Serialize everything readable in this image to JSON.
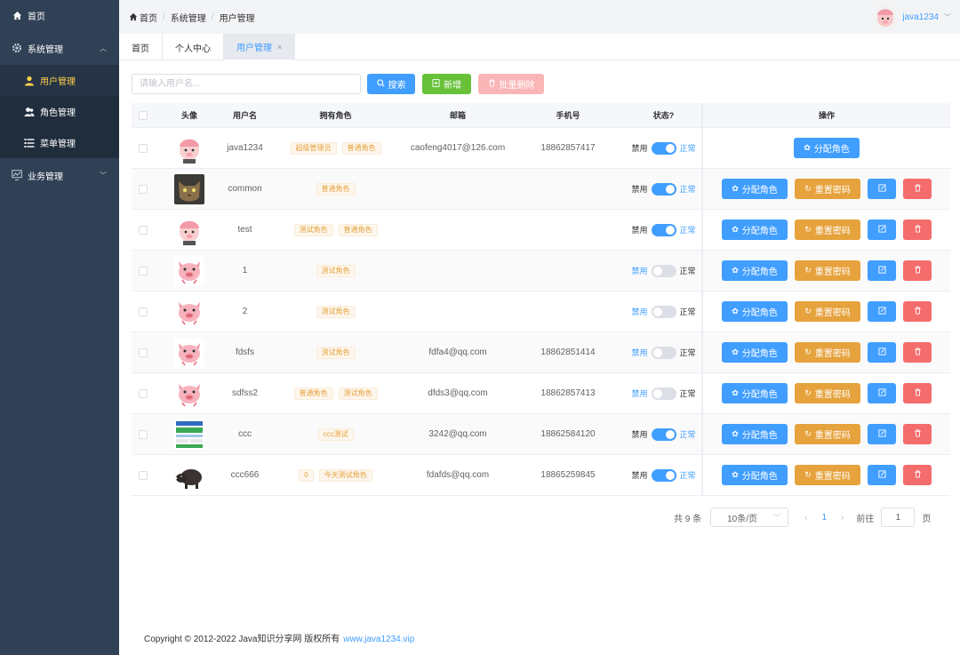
{
  "sidebar": {
    "home": "首页",
    "system": "系统管理",
    "items": [
      "用户管理",
      "角色管理",
      "菜单管理"
    ],
    "business": "业务管理"
  },
  "header": {
    "crumbs": [
      "首页",
      "系统管理",
      "用户管理"
    ],
    "username": "java1234"
  },
  "tabs": [
    "首页",
    "个人中心",
    "用户管理"
  ],
  "toolbar": {
    "placeholder": "请输入用户名...",
    "search": "搜索",
    "add": "新增",
    "batch_delete": "批量删除"
  },
  "table": {
    "headers": [
      "头像",
      "用户名",
      "拥有角色",
      "邮箱",
      "手机号",
      "状态?",
      "操作"
    ],
    "status_off": "禁用",
    "status_on": "正常",
    "assign": "分配角色",
    "reset": "重置密码",
    "rows": [
      {
        "username": "java1234",
        "roles": [
          "超级管理员",
          "普通角色"
        ],
        "email": "caofeng4017@126.com",
        "phone": "18862857417",
        "enabled": true,
        "avatar": "pig-face",
        "admin": true
      },
      {
        "username": "common",
        "roles": [
          "普通角色"
        ],
        "email": "",
        "phone": "",
        "enabled": true,
        "avatar": "cat-photo",
        "admin": false
      },
      {
        "username": "test",
        "roles": [
          "测试角色",
          "普通角色"
        ],
        "email": "",
        "phone": "",
        "enabled": true,
        "avatar": "pig-face",
        "admin": false
      },
      {
        "username": "1",
        "roles": [
          "测试角色"
        ],
        "email": "",
        "phone": "",
        "enabled": false,
        "avatar": "pig-cartoon",
        "admin": false
      },
      {
        "username": "2",
        "roles": [
          "测试角色"
        ],
        "email": "",
        "phone": "",
        "enabled": false,
        "avatar": "pig-cartoon",
        "admin": false
      },
      {
        "username": "fdsfs",
        "roles": [
          "测试角色"
        ],
        "email": "fdfa4@qq.com",
        "phone": "18862851414",
        "enabled": false,
        "avatar": "pig-cartoon",
        "admin": false
      },
      {
        "username": "sdfss2",
        "roles": [
          "普通角色",
          "测试角色"
        ],
        "email": "dfds3@qq.com",
        "phone": "18862857413",
        "enabled": false,
        "avatar": "pig-cartoon",
        "admin": false
      },
      {
        "username": "ccc",
        "roles": [
          "ccc测试"
        ],
        "email": "3242@qq.com",
        "phone": "18862584120",
        "enabled": true,
        "avatar": "web-screenshot",
        "admin": false
      },
      {
        "username": "ccc666",
        "roles": [
          "0",
          "今天测试角色"
        ],
        "email": "fdafds@qq.com",
        "phone": "18865259845",
        "enabled": true,
        "avatar": "boar-photo",
        "admin": false
      }
    ]
  },
  "pager": {
    "total": "共 9 条",
    "size": "10条/页",
    "page": "1",
    "goto_prefix": "前往",
    "goto_value": "1",
    "goto_suffix": "页"
  },
  "footer": {
    "text": "Copyright © 2012-2022 Java知识分享网 版权所有",
    "link": "www.java1234.vip"
  },
  "colors": {
    "sidebar": "#304156",
    "primary": "#409eff",
    "success": "#67c23a",
    "warning": "#e6a23c",
    "danger": "#f56c6c"
  }
}
